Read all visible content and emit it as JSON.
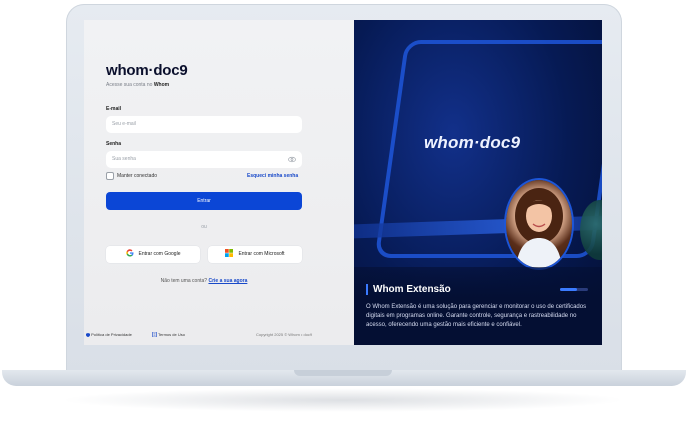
{
  "login": {
    "logo": "whom·doc9",
    "subtitle_prefix": "Acesse sua conta no",
    "subtitle_brand": "Whom",
    "email_label": "E-mail",
    "email_placeholder": "Seu e-mail",
    "password_label": "Senha",
    "password_placeholder": "Sua senha",
    "remember_label": "Manter conectado",
    "forgot_link": "Esqueci minha senha",
    "submit_label": "Entrar",
    "or_label": "ou",
    "google_label": "Entrar com Google",
    "microsoft_label": "Entrar com Microsoft",
    "no_account": "Não tem uma conta?",
    "signup_link": "Crie a sua agora"
  },
  "footer": {
    "privacy": "Política de Privacidade",
    "terms": "Termos de Uso",
    "copyright": "Copyright 2025 © Whom • doc9"
  },
  "promo": {
    "logo": "whom·doc9",
    "title": "Whom Extensão",
    "description": "O Whom Extensão é uma solução para gerenciar e monitorar o uso de certificados digitais em programas online. Garante controle, segurança e rastreabilidade no acesso, oferecendo uma gestão mais eficiente e confiável.",
    "carousel_progress": 0.6
  },
  "colors": {
    "primary": "#0b46d6",
    "link": "#1849c9",
    "promo_bg": "#061a54"
  }
}
